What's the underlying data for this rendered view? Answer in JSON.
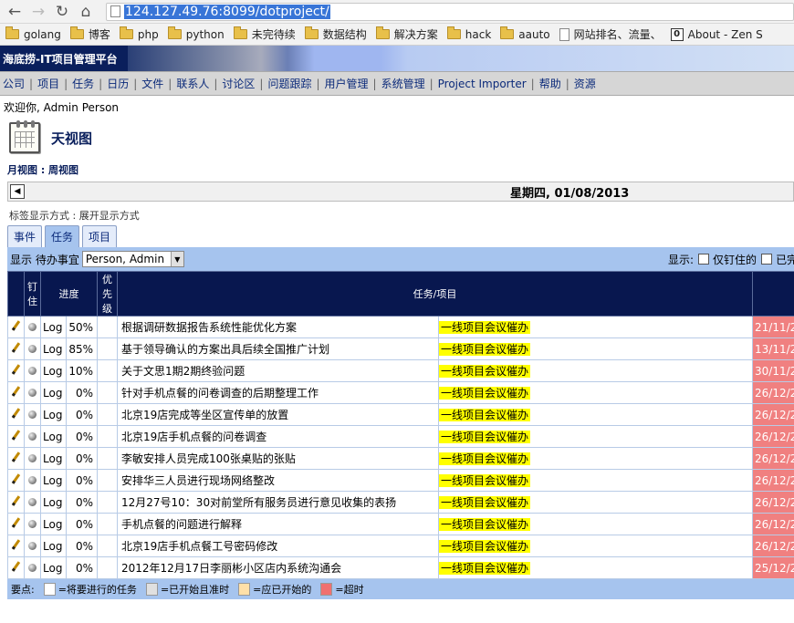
{
  "browser": {
    "url": "124.127.49.76:8099/dotproject/",
    "bookmarks": [
      {
        "label": "golang",
        "icon": "folder"
      },
      {
        "label": "博客",
        "icon": "folder"
      },
      {
        "label": "php",
        "icon": "folder"
      },
      {
        "label": "python",
        "icon": "folder"
      },
      {
        "label": "未完待续",
        "icon": "folder"
      },
      {
        "label": "数据结构",
        "icon": "folder"
      },
      {
        "label": "解决方案",
        "icon": "folder"
      },
      {
        "label": "hack",
        "icon": "folder"
      },
      {
        "label": "aauto",
        "icon": "folder"
      },
      {
        "label": "网站排名、流量、",
        "icon": "page"
      },
      {
        "label": "About - Zen S",
        "icon": "zen"
      }
    ]
  },
  "app": {
    "title": "海底捞-IT项目管理平台",
    "menu": [
      "公司",
      "项目",
      "任务",
      "日历",
      "文件",
      "联系人",
      "讨论区",
      "问题跟踪",
      "用户管理",
      "系统管理",
      "Project Importer",
      "帮助",
      "资源"
    ],
    "welcome": "欢迎你, Admin Person"
  },
  "page": {
    "title": "天视图",
    "subnav": "月视图 : 周视图",
    "date": "星期四, 01/08/2013",
    "tabview": "标签显示方式 : 展开显示方式",
    "tabs": [
      {
        "label": "事件",
        "active": false
      },
      {
        "label": "任务",
        "active": true
      },
      {
        "label": "项目",
        "active": false
      }
    ]
  },
  "filter": {
    "show_label": "显示",
    "todo_label": "待办事宜",
    "selected_user": "Person, Admin",
    "right_label": "显示:",
    "pinned_only": "仅钉住的",
    "done_prefix": "已完"
  },
  "table": {
    "headers": {
      "pin": "钉住",
      "progress": "进度",
      "priority": "优先级",
      "task": "任务/项目"
    },
    "rows": [
      {
        "log": "Log",
        "pct": "50%",
        "name": "根据调研数据报告系统性能优化方案",
        "project": "一线项目会议催办",
        "date": "21/11/2"
      },
      {
        "log": "Log",
        "pct": "85%",
        "name": "基于领导确认的方案出具后续全国推广计划",
        "project": "一线项目会议催办",
        "date": "13/11/2"
      },
      {
        "log": "Log",
        "pct": "10%",
        "name": "关于文思1期2期终验问题",
        "project": "一线项目会议催办",
        "date": "30/11/2"
      },
      {
        "log": "Log",
        "pct": "0%",
        "name": "针对手机点餐的问卷调查的后期整理工作",
        "project": "一线项目会议催办",
        "date": "26/12/2"
      },
      {
        "log": "Log",
        "pct": "0%",
        "name": "北京19店完成等坐区宣传单的放置",
        "project": "一线项目会议催办",
        "date": "26/12/2"
      },
      {
        "log": "Log",
        "pct": "0%",
        "name": "北京19店手机点餐的问卷调查",
        "project": "一线项目会议催办",
        "date": "26/12/2"
      },
      {
        "log": "Log",
        "pct": "0%",
        "name": "李敏安排人员完成100张桌贴的张贴",
        "project": "一线项目会议催办",
        "date": "26/12/2"
      },
      {
        "log": "Log",
        "pct": "0%",
        "name": "安排华三人员进行现场网络整改",
        "project": "一线项目会议催办",
        "date": "26/12/2"
      },
      {
        "log": "Log",
        "pct": "0%",
        "name": "12月27号10：30对前堂所有服务员进行意见收集的表扬",
        "project": "一线项目会议催办",
        "date": "26/12/2"
      },
      {
        "log": "Log",
        "pct": "0%",
        "name": "手机点餐的问题进行解释",
        "project": "一线项目会议催办",
        "date": "26/12/2"
      },
      {
        "log": "Log",
        "pct": "0%",
        "name": "北京19店手机点餐工号密码修改",
        "project": "一线项目会议催办",
        "date": "26/12/2"
      },
      {
        "log": "Log",
        "pct": "0%",
        "name": "2012年12月17日李丽彬小区店内系统沟通会",
        "project": "一线项目会议催办",
        "date": "25/12/2"
      }
    ]
  },
  "legend": {
    "label": "要点:",
    "items": [
      {
        "color": "#ffffff",
        "text": "=将要进行的任务"
      },
      {
        "color": "#e0e0e0",
        "text": "=已开始且准时"
      },
      {
        "color": "#ffe0a8",
        "text": "=应已开始的"
      },
      {
        "color": "#f07070",
        "text": "=超时"
      }
    ]
  }
}
